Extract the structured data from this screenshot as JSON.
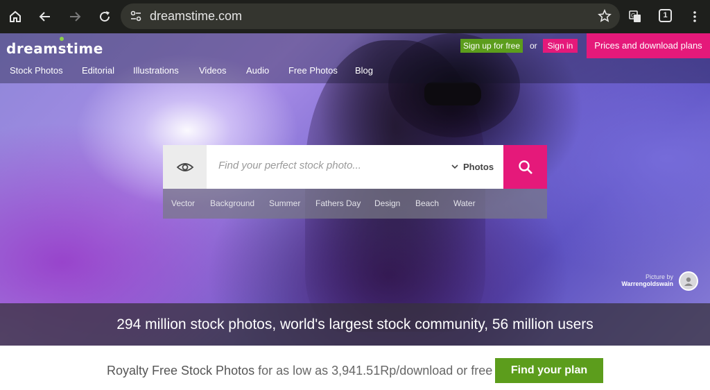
{
  "browser": {
    "url": "dreamstime.com",
    "tab_count": "1",
    "icons": [
      "home-icon",
      "back-icon",
      "forward-icon",
      "reload-icon",
      "site-settings-icon",
      "star-icon",
      "translate-icon",
      "menu-icon"
    ]
  },
  "header": {
    "logo": "dreamstime",
    "signup_label": "Sign up for free",
    "or_label": "or",
    "signin_label": "Sign in",
    "prices_label": "Prices and download plans"
  },
  "nav": {
    "items": [
      "Stock Photos",
      "Editorial",
      "Illustrations",
      "Videos",
      "Audio",
      "Free Photos",
      "Blog"
    ]
  },
  "search": {
    "placeholder": "Find your perfect stock photo...",
    "type_label": "Photos",
    "tags": [
      "Vector",
      "Background",
      "Summer",
      "Fathers Day",
      "Design",
      "Beach",
      "Water"
    ]
  },
  "credit": {
    "by": "Picture by",
    "name": "Warrengoldswain"
  },
  "stats": "294 million stock photos, world's largest stock community, 56 million users",
  "bottom": {
    "title": "Royalty Free Stock Photos",
    "rest": " for as low as 3,941.51Rp/download or free",
    "cta": "Find your plan"
  },
  "colors": {
    "brand_pink": "#e5197a",
    "brand_green": "#5c9d1c"
  }
}
